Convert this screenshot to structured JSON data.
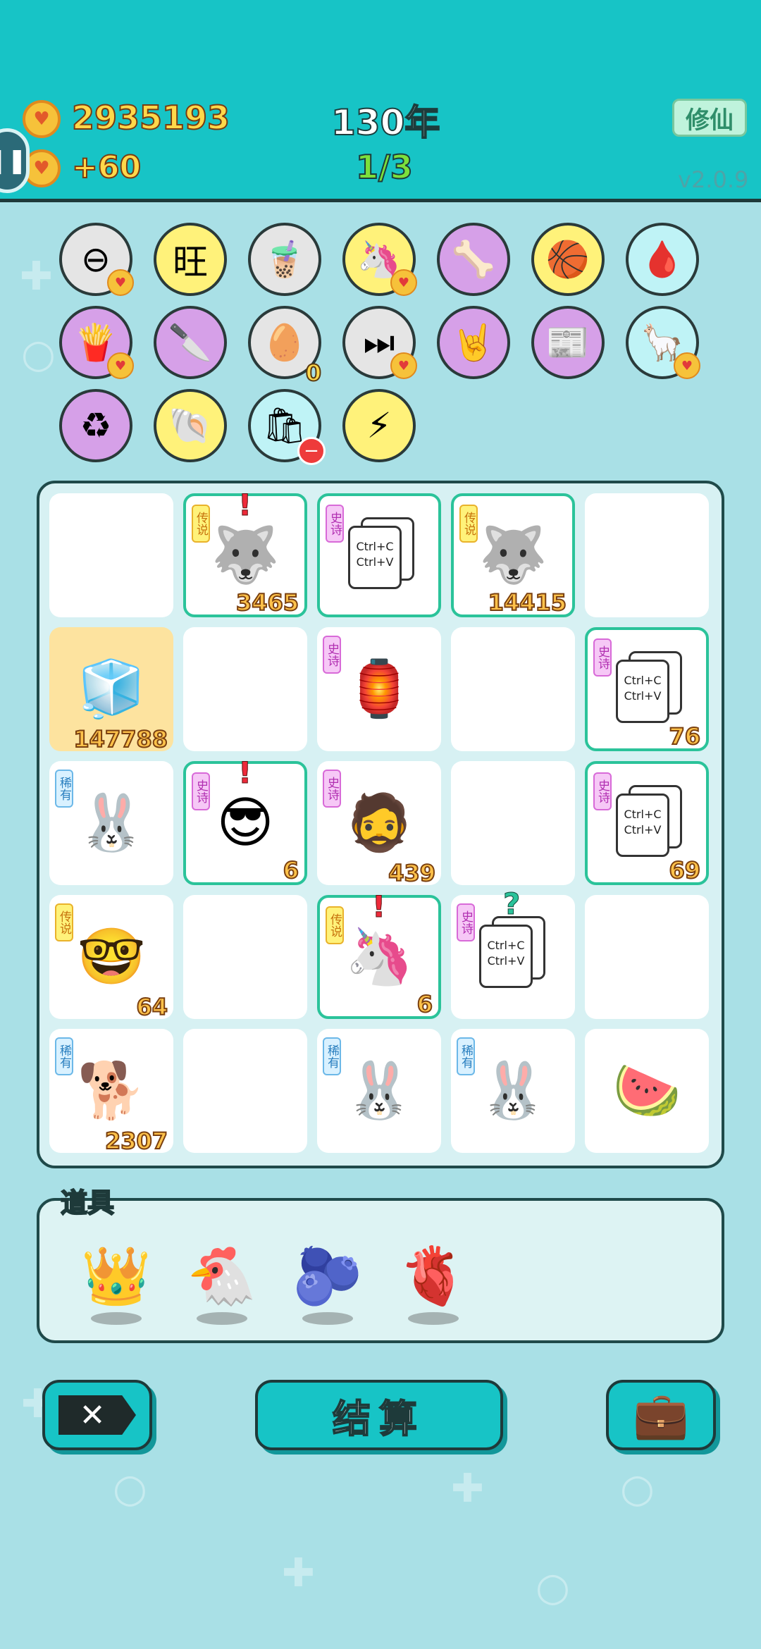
{
  "header": {
    "coins": "2935193",
    "income": "+60",
    "year": "130年",
    "progress": "1/3",
    "mode_button": "修仙",
    "version": "v2.0.9"
  },
  "traits": [
    {
      "name": "no-entry",
      "glyph": "⊖",
      "bg": "#e5e5e5",
      "badge": "heart"
    },
    {
      "name": "wang-dice",
      "glyph": "旺",
      "bg": "#fff27a",
      "badge": ""
    },
    {
      "name": "bubble-tea",
      "glyph": "🧋",
      "bg": "#e5e5e5",
      "badge": ""
    },
    {
      "name": "unicorn",
      "glyph": "🦄",
      "bg": "#fff27a",
      "badge": "heart"
    },
    {
      "name": "dog-bowl",
      "glyph": "🦴",
      "bg": "#d6a0e8",
      "badge": ""
    },
    {
      "name": "basketballs",
      "glyph": "🏀",
      "bg": "#fff27a",
      "badge": ""
    },
    {
      "name": "blood-bag",
      "glyph": "🩸",
      "bg": "#bff3f6",
      "badge": ""
    },
    {
      "name": "fries",
      "glyph": "🍟",
      "bg": "#d6a0e8",
      "badge": "heart"
    },
    {
      "name": "cleaver",
      "glyph": "🔪",
      "bg": "#d6a0e8",
      "badge": ""
    },
    {
      "name": "egg-tray",
      "glyph": "🥚",
      "bg": "#e5e5e5",
      "badge": "count",
      "count": "0"
    },
    {
      "name": "skip",
      "glyph": "⏭",
      "bg": "#e5e5e5",
      "badge": "heart"
    },
    {
      "name": "rock-hand",
      "glyph": "🤘",
      "bg": "#d6a0e8",
      "badge": ""
    },
    {
      "name": "time-magazine",
      "glyph": "📰",
      "bg": "#d6a0e8",
      "badge": ""
    },
    {
      "name": "alpacas",
      "glyph": "🦙",
      "bg": "#bff3f6",
      "badge": "heart"
    },
    {
      "name": "recycle",
      "glyph": "♻",
      "bg": "#d6a0e8",
      "badge": ""
    },
    {
      "name": "shell",
      "glyph": "🐚",
      "bg": "#fff27a",
      "badge": ""
    },
    {
      "name": "garbage-bag",
      "glyph": "🛍",
      "bg": "#bff3f6",
      "badge": "minus"
    },
    {
      "name": "lightning",
      "glyph": "⚡",
      "bg": "#fff27a",
      "badge": ""
    }
  ],
  "board": [
    {
      "tag": "",
      "tagClass": "",
      "item": "",
      "num": "",
      "mark": "",
      "style": ""
    },
    {
      "tag": "传说",
      "tagClass": "leg",
      "item": "🐺",
      "num": "3465",
      "mark": "!",
      "style": "hl"
    },
    {
      "tag": "史诗",
      "tagClass": "epic",
      "item": "ctrl",
      "num": "",
      "mark": "",
      "style": "hl"
    },
    {
      "tag": "传说",
      "tagClass": "leg",
      "item": "🐺",
      "num": "14415",
      "mark": "",
      "style": "hl"
    },
    {
      "tag": "",
      "tagClass": "",
      "item": "",
      "num": "",
      "mark": "",
      "style": ""
    },
    {
      "tag": "",
      "tagClass": "",
      "item": "🧊",
      "num": "147788",
      "mark": "",
      "style": "fridge"
    },
    {
      "tag": "",
      "tagClass": "",
      "item": "",
      "num": "",
      "mark": "",
      "style": ""
    },
    {
      "tag": "史诗",
      "tagClass": "epic",
      "item": "🏮",
      "num": "",
      "mark": "",
      "style": ""
    },
    {
      "tag": "",
      "tagClass": "",
      "item": "",
      "num": "",
      "mark": "",
      "style": ""
    },
    {
      "tag": "史诗",
      "tagClass": "epic",
      "item": "ctrl",
      "num": "76",
      "mark": "",
      "style": "hl"
    },
    {
      "tag": "稀有",
      "tagClass": "rare",
      "item": "🐰",
      "num": "",
      "mark": "",
      "style": ""
    },
    {
      "tag": "史诗",
      "tagClass": "epic",
      "item": "😎",
      "num": "6",
      "mark": "!",
      "style": "hl"
    },
    {
      "tag": "史诗",
      "tagClass": "epic",
      "item": "🧔",
      "num": "439",
      "mark": "",
      "style": ""
    },
    {
      "tag": "",
      "tagClass": "",
      "item": "",
      "num": "",
      "mark": "",
      "style": ""
    },
    {
      "tag": "史诗",
      "tagClass": "epic",
      "item": "ctrl",
      "num": "69",
      "mark": "",
      "style": "hl"
    },
    {
      "tag": "传说",
      "tagClass": "leg",
      "item": "🤓",
      "num": "64",
      "mark": "",
      "style": ""
    },
    {
      "tag": "",
      "tagClass": "",
      "item": "",
      "num": "",
      "mark": "",
      "style": ""
    },
    {
      "tag": "传说",
      "tagClass": "leg",
      "item": "🦄",
      "num": "6",
      "mark": "!",
      "style": "hl"
    },
    {
      "tag": "史诗",
      "tagClass": "epic",
      "item": "ctrl",
      "num": "",
      "mark": "?",
      "style": ""
    },
    {
      "tag": "",
      "tagClass": "",
      "item": "",
      "num": "",
      "mark": "",
      "style": ""
    },
    {
      "tag": "稀有",
      "tagClass": "rare",
      "item": "🐕",
      "num": "2307",
      "mark": "",
      "style": ""
    },
    {
      "tag": "",
      "tagClass": "",
      "item": "",
      "num": "",
      "mark": "",
      "style": ""
    },
    {
      "tag": "稀有",
      "tagClass": "rare",
      "item": "🐰",
      "num": "",
      "mark": "",
      "style": ""
    },
    {
      "tag": "稀有",
      "tagClass": "rare",
      "item": "🐰",
      "num": "",
      "mark": "",
      "style": ""
    },
    {
      "tag": "",
      "tagClass": "",
      "item": "🍉",
      "num": "",
      "mark": "",
      "style": ""
    }
  ],
  "ctrl_text": [
    "Ctrl+C",
    "Ctrl+V"
  ],
  "props": {
    "label": "道具",
    "items": [
      {
        "name": "crown",
        "glyph": "👑"
      },
      {
        "name": "chicken",
        "glyph": "🐔"
      },
      {
        "name": "blueberry",
        "glyph": "🫐"
      },
      {
        "name": "liver",
        "glyph": "🫀"
      }
    ]
  },
  "buttons": {
    "settle": "结算",
    "close_glyph": "✕",
    "bag_glyph": "💼"
  },
  "colors": {
    "accent": "#17c4c6",
    "highlight": "#2bc39a",
    "gold": "#ffd84a"
  }
}
